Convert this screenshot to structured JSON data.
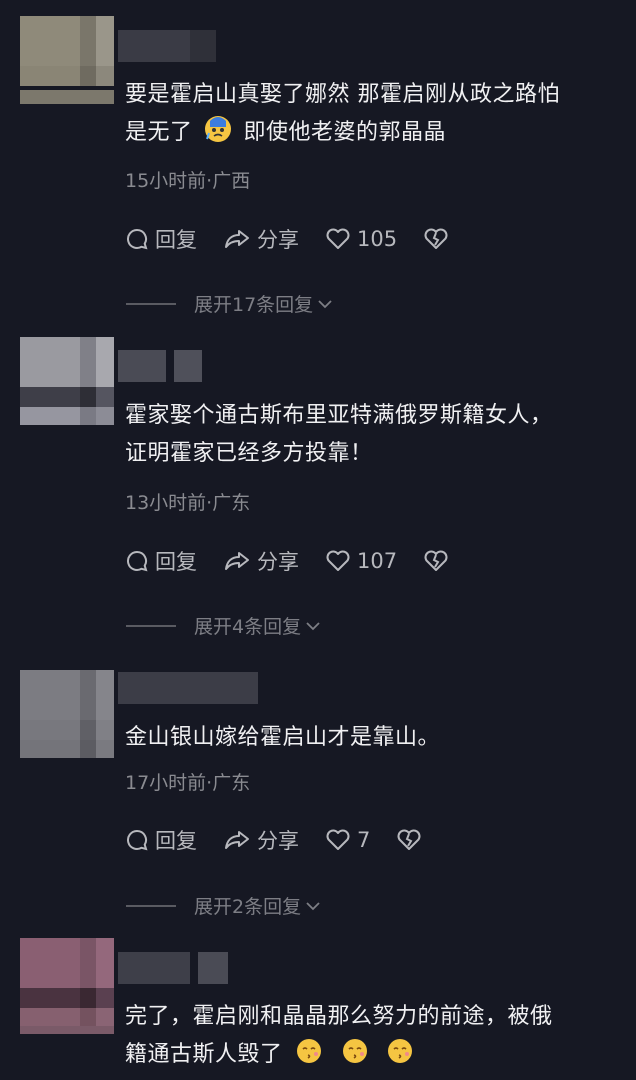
{
  "comments": [
    {
      "text_lines": [
        "要是霍启山真娶了娜然 那霍启刚从政之路怕",
        "是无了",
        "即使他老婆的郭晶晶"
      ],
      "meta": "15小时前·广西",
      "reply_label": "回复",
      "share_label": "分享",
      "likes": "105",
      "expand_label": "展开17条回复"
    },
    {
      "text_lines": [
        "霍家娶个通古斯布里亚特满俄罗斯籍女人，",
        "证明霍家已经多方投靠！"
      ],
      "meta": "13小时前·广东",
      "reply_label": "回复",
      "share_label": "分享",
      "likes": "107",
      "expand_label": "展开4条回复"
    },
    {
      "text_lines": [
        "金山银山嫁给霍启山才是靠山。"
      ],
      "meta": "17小时前·广东",
      "reply_label": "回复",
      "share_label": "分享",
      "likes": "7",
      "expand_label": "展开2条回复"
    },
    {
      "text_lines": [
        "完了，霍启刚和晶晶那么努力的前途，被俄",
        "籍通古斯人毁了"
      ]
    }
  ],
  "icons": {
    "reply": "comment-bubble-icon",
    "share": "share-arrow-icon",
    "like": "heart-icon",
    "dislike": "broken-heart-icon",
    "expand": "chevron-down-icon",
    "emoji_1": "crying-face-emoji",
    "emoji_4": "kissing-face-emoji"
  },
  "colors": {
    "background": "#161823",
    "text": "#f0f0f2",
    "meta": "#8a8b91",
    "action": "#b7b8bd"
  }
}
